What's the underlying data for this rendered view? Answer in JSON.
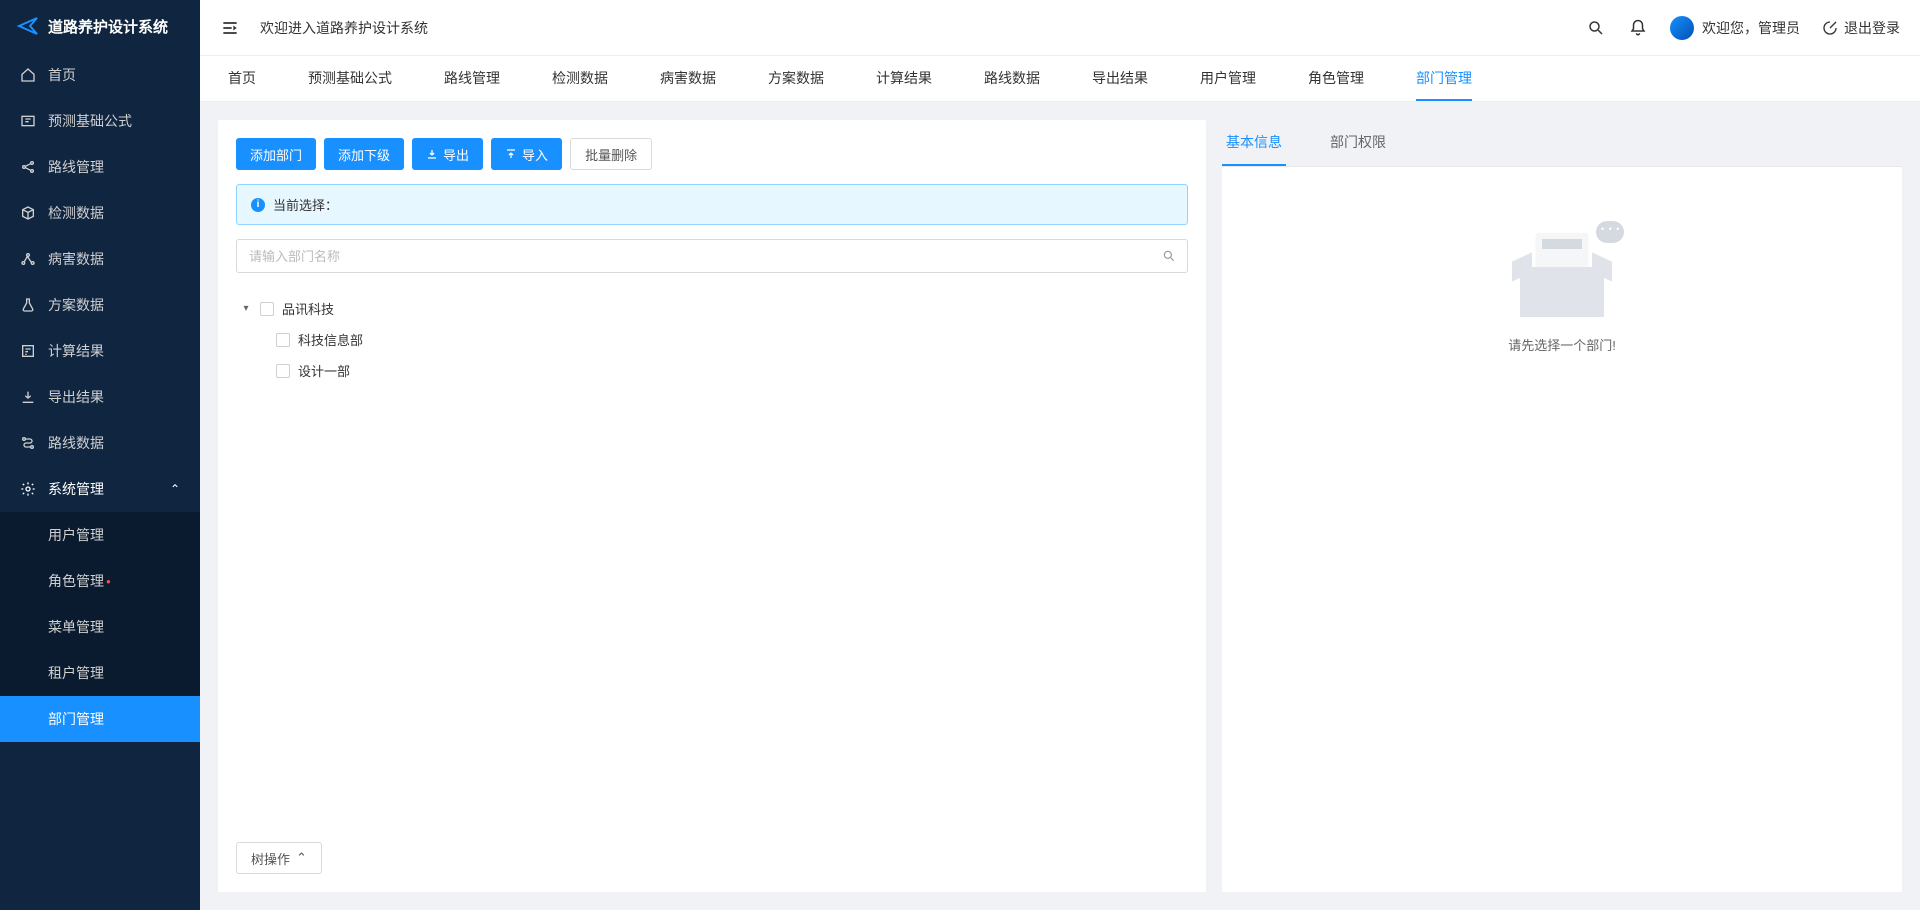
{
  "app": {
    "title": "道路养护设计系统"
  },
  "header": {
    "welcome": "欢迎进入道路养护设计系统",
    "user_greeting": "欢迎您，管理员",
    "logout": "退出登录"
  },
  "sidebar": {
    "items": [
      {
        "label": "首页",
        "icon": "home"
      },
      {
        "label": "预测基础公式",
        "icon": "formula"
      },
      {
        "label": "路线管理",
        "icon": "share"
      },
      {
        "label": "检测数据",
        "icon": "cube"
      },
      {
        "label": "病害数据",
        "icon": "network"
      },
      {
        "label": "方案数据",
        "icon": "flask"
      },
      {
        "label": "计算结果",
        "icon": "calc"
      },
      {
        "label": "导出结果",
        "icon": "download"
      },
      {
        "label": "路线数据",
        "icon": "route"
      }
    ],
    "system": {
      "label": "系统管理",
      "children": [
        {
          "label": "用户管理"
        },
        {
          "label": "角色管理",
          "dot": true
        },
        {
          "label": "菜单管理"
        },
        {
          "label": "租户管理"
        },
        {
          "label": "部门管理",
          "active": true
        }
      ]
    }
  },
  "tabs": {
    "items": [
      "首页",
      "预测基础公式",
      "路线管理",
      "检测数据",
      "病害数据",
      "方案数据",
      "计算结果",
      "路线数据",
      "导出结果",
      "用户管理",
      "角色管理",
      "部门管理"
    ],
    "active": "部门管理"
  },
  "toolbar": {
    "add_dept": "添加部门",
    "add_sub": "添加下级",
    "export": "导出",
    "import": "导入",
    "batch_delete": "批量删除"
  },
  "alert": {
    "label": "当前选择："
  },
  "search": {
    "placeholder": "请输入部门名称"
  },
  "tree": {
    "root": "品讯科技",
    "children": [
      {
        "label": "科技信息部"
      },
      {
        "label": "设计一部"
      }
    ]
  },
  "tree_ops": {
    "label": "树操作"
  },
  "right": {
    "tabs": {
      "basic": "基本信息",
      "perm": "部门权限",
      "active": "basic"
    },
    "empty_text": "请先选择一个部门!"
  }
}
